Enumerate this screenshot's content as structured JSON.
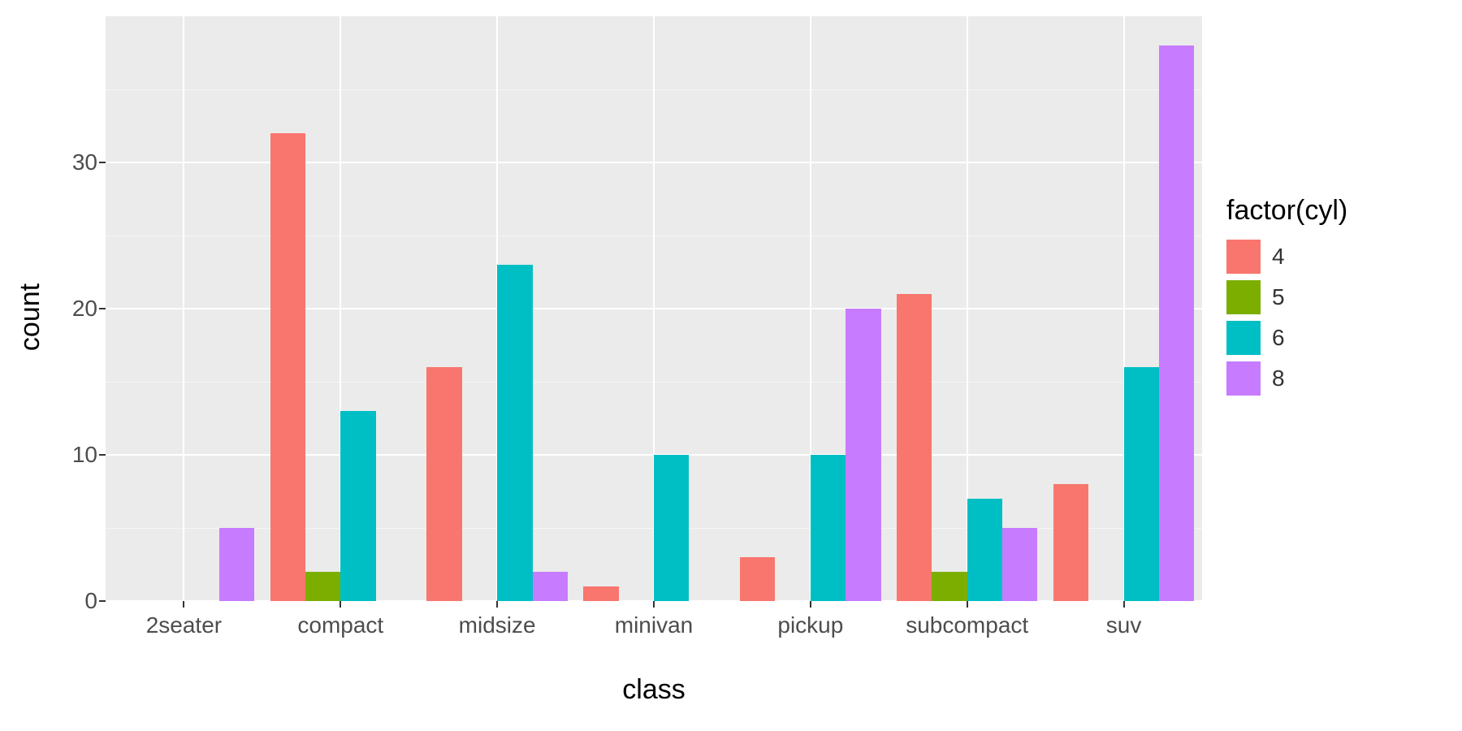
{
  "chart_data": {
    "type": "bar",
    "xlabel": "class",
    "ylabel": "count",
    "legend_title": "factor(cyl)",
    "ylim": [
      0,
      40
    ],
    "y_breaks": [
      0,
      10,
      20,
      30
    ],
    "y_minor": [
      5,
      15,
      25,
      35
    ],
    "categories": [
      "2seater",
      "compact",
      "midsize",
      "minivan",
      "pickup",
      "subcompact",
      "suv"
    ],
    "series": [
      {
        "name": "4",
        "color": "#F8766D",
        "values": [
          0,
          32,
          16,
          1,
          3,
          21,
          8
        ]
      },
      {
        "name": "5",
        "color": "#7CAE00",
        "values": [
          0,
          2,
          0,
          0,
          0,
          2,
          0
        ]
      },
      {
        "name": "6",
        "color": "#00BFC4",
        "values": [
          0,
          13,
          23,
          10,
          10,
          7,
          16
        ]
      },
      {
        "name": "8",
        "color": "#C77CFF",
        "values": [
          5,
          0,
          2,
          0,
          20,
          5,
          38
        ]
      }
    ]
  }
}
